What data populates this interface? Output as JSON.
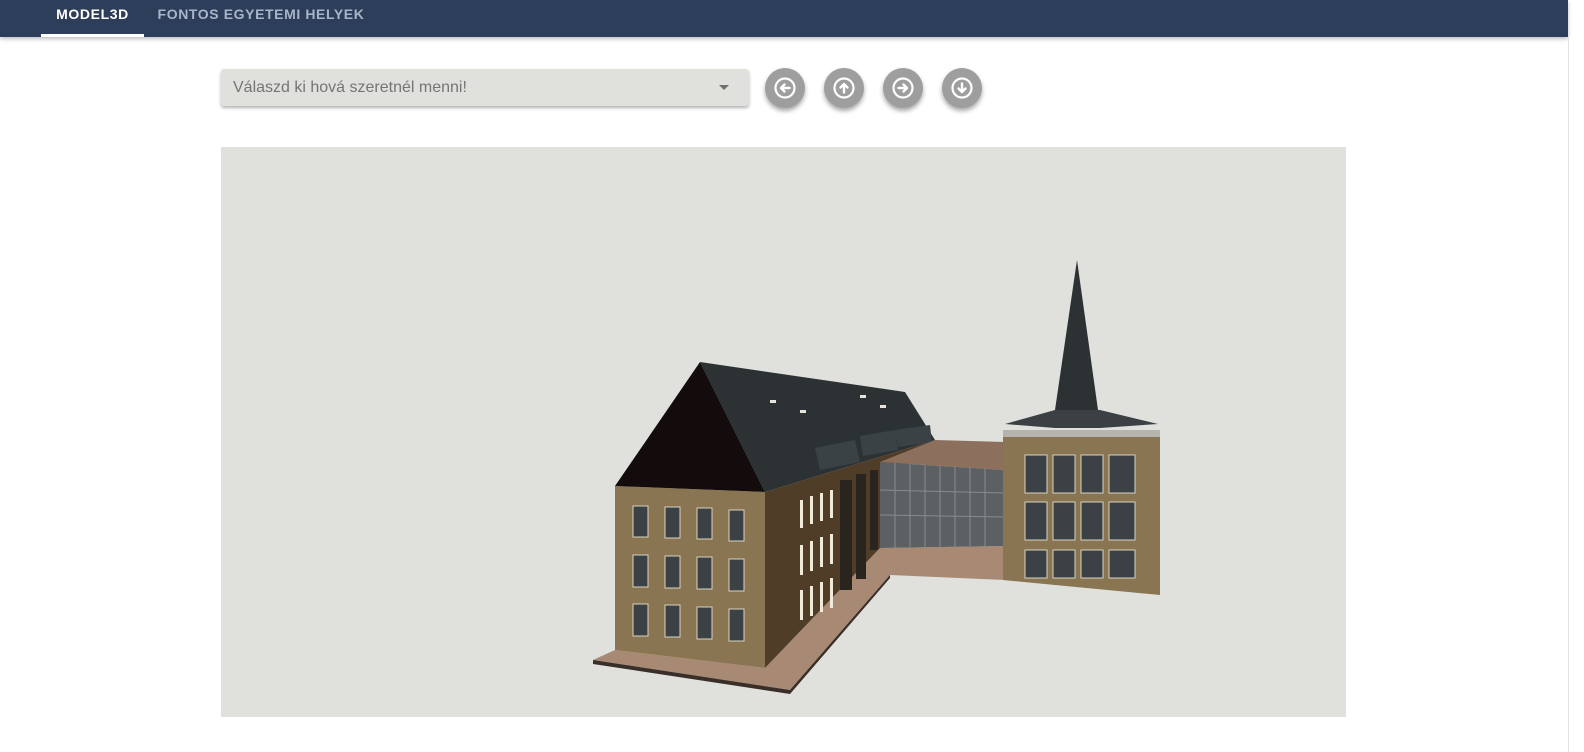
{
  "nav": {
    "tabs": [
      {
        "label": "MODEL3D",
        "active": true
      },
      {
        "label": "FONTOS EGYETEMI HELYEK",
        "active": false
      }
    ]
  },
  "location_select": {
    "placeholder": "Válaszd ki hová szeretnél menni!",
    "value": ""
  },
  "camera_controls": [
    {
      "icon": "arrow-left-circle-icon"
    },
    {
      "icon": "arrow-up-circle-icon"
    },
    {
      "icon": "arrow-right-circle-icon"
    },
    {
      "icon": "arrow-down-circle-icon"
    }
  ],
  "colors": {
    "nav_background": "#2c3e5a",
    "viewport_background": "#e0e0dd",
    "button_gray": "#9e9e9e",
    "facade": "#8a7552",
    "roof": "#2c3234"
  }
}
